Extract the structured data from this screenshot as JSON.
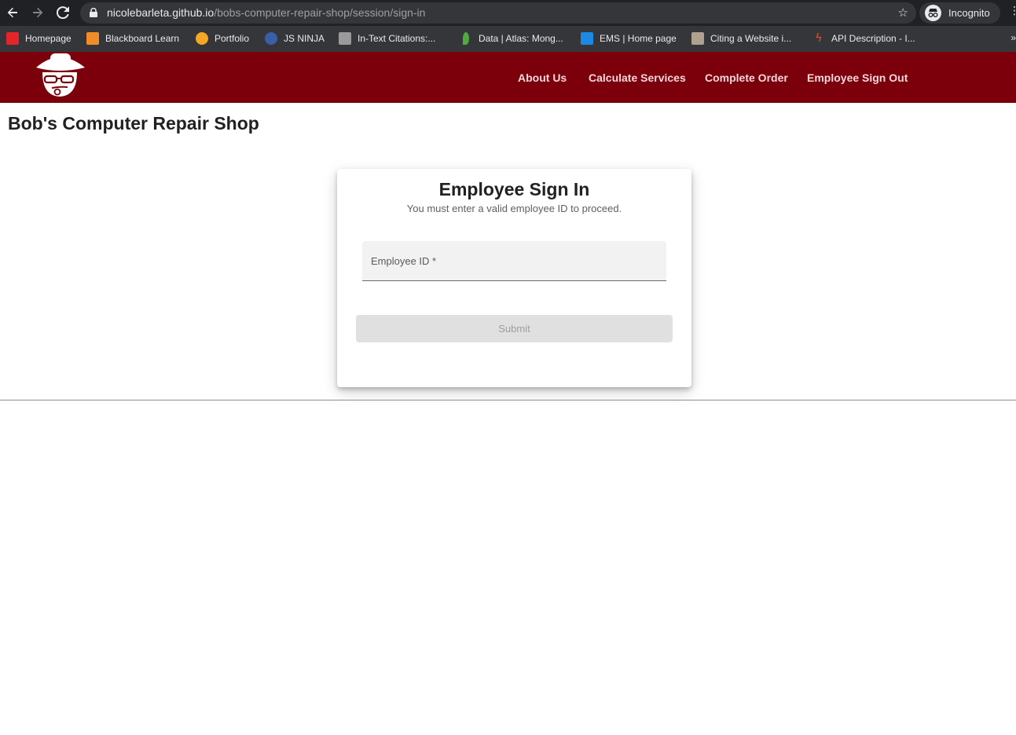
{
  "browser": {
    "url_host": "nicolebarleta.github.io",
    "url_path": "/bobs-computer-repair-shop/session/sign-in",
    "profile_label": "Incognito",
    "bookmarks": [
      {
        "label": "Homepage",
        "color": "#e4262b"
      },
      {
        "label": "Blackboard Learn",
        "color": "#f28c28"
      },
      {
        "label": "Portfolio",
        "color": "#f5a623"
      },
      {
        "label": "JS NINJA",
        "color": "#3a5fa8"
      },
      {
        "label": "In-Text Citations:...",
        "color": "#9a9a9a"
      },
      {
        "label": "Data | Atlas: Mong...",
        "color": "#4faa41"
      },
      {
        "label": "EMS | Home page",
        "color": "#1e88e5"
      },
      {
        "label": "Citing a Website i...",
        "color": "#b0a090"
      },
      {
        "label": "API Description - I...",
        "color": "#e8572a"
      }
    ],
    "bookmarks_more": "»"
  },
  "header": {
    "bg_color": "#7b000b",
    "nav": {
      "about": "About Us",
      "calculate": "Calculate Services",
      "complete": "Complete Order",
      "signout": "Employee Sign Out"
    }
  },
  "page": {
    "site_title": "Bob's Computer Repair Shop"
  },
  "signin": {
    "title": "Employee Sign In",
    "subtitle": "You must enter a valid employee ID to proceed.",
    "employee_id_label": "Employee ID *",
    "employee_id_value": "",
    "submit_label": "Submit"
  }
}
